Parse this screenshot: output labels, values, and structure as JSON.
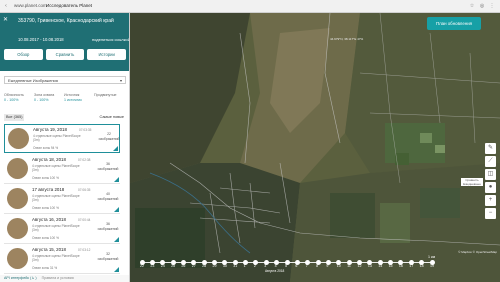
{
  "browser": {
    "url": "www.planet.com",
    "page_title": "Исследователь Planet"
  },
  "header": {
    "place": "353790, Гривенское, Краснодарский край",
    "dates": "10.08.2017 - 10.08.2018",
    "share": "поделиться ссылкой",
    "tabs": [
      "Обзор",
      "Сравнить",
      "Истории"
    ]
  },
  "image_type": "Ежедневные Изображения",
  "filters": {
    "cloud_label": "Облачность",
    "cloud_value": "0 - 100%",
    "zone_label": "Зона охвата",
    "zone_value": "0 - 100%",
    "source_label": "Источник",
    "source_value": "1 источник",
    "advanced": "Продвинутые"
  },
  "list": {
    "count": "Все (365)",
    "sort": "Самые новые"
  },
  "items": [
    {
      "date": "Августа 19, 2018",
      "time": "07:03:35",
      "sub": "4 отдельные сцены PlanetScope (3m)",
      "cloud": "Охват зоны 94 %",
      "count": "22",
      "count_label": "изображений"
    },
    {
      "date": "Августа 18, 2018",
      "time": "07:02:38",
      "sub": "4 отдельные сцены PlanetScope (3m)",
      "cloud": "Охват зоны 100 %",
      "count": "36",
      "count_label": "изображений"
    },
    {
      "date": "17 августа 2018",
      "time": "07:06:35",
      "sub": "4 отдельные сцены PlanetScope (3m)",
      "cloud": "Охват зоны 100 %",
      "count": "40",
      "count_label": "изображений"
    },
    {
      "date": "Августа 16, 2018",
      "time": "07:00:44",
      "sub": "4 отдельные сцены PlanetScope (3m)",
      "cloud": "Охват зоны 100 %",
      "count": "36",
      "count_label": "изображений"
    },
    {
      "date": "Августа 15, 2018",
      "time": "07:03:12",
      "sub": "4 отдельные сцены PlanetScope (3m)",
      "cloud": "Охват зоны 31 %",
      "count": "32",
      "count_label": "изображений"
    }
  ],
  "footer": {
    "api": "API интерфейс (↳ )",
    "terms": "Правила и условия"
  },
  "update_button": "План обновления",
  "compare_box": "Сравнить Ежедневные",
  "timeline": {
    "ticks": [
      "22",
      "23",
      "24",
      "25",
      "26",
      "27",
      "28",
      "29",
      "30",
      "31",
      "1",
      "2",
      "3",
      "4",
      "5",
      "6",
      "7",
      "8",
      "9",
      "10",
      "11",
      "12",
      "13",
      "14",
      "15",
      "16",
      "17",
      "18",
      "19"
    ],
    "month": "Августа 2018"
  },
  "scale": "1 км",
  "coords": "44.979°N, 38.117°E   47%",
  "attribution": "© Mapbox © OpenStreetMap"
}
